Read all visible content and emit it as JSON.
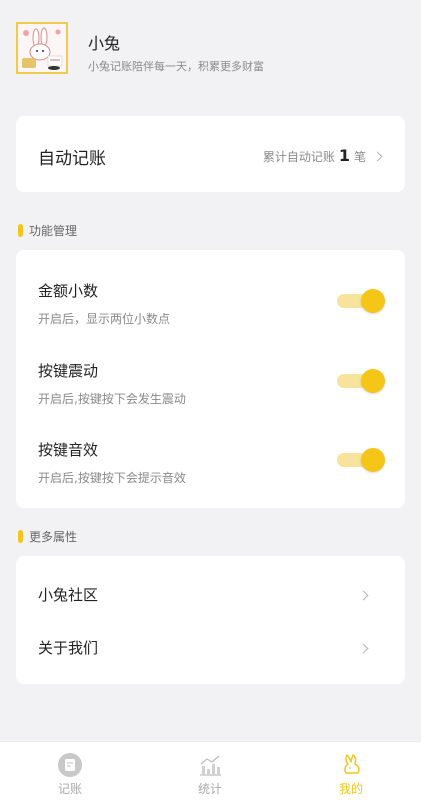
{
  "profile": {
    "name": "小兔",
    "subtitle": "小兔记账陪伴每一天，积累更多财富"
  },
  "auto_record": {
    "title": "自动记账",
    "prefix": "累计自动记账",
    "count": "1",
    "suffix": "笔"
  },
  "features": {
    "section_label": "功能管理",
    "items": [
      {
        "title": "金额小数",
        "desc": "开启后，显示两位小数点",
        "enabled": true
      },
      {
        "title": "按键震动",
        "desc": "开启后,按键按下会发生震动",
        "enabled": true
      },
      {
        "title": "按键音效",
        "desc": "开启后,按键按下会提示音效",
        "enabled": true
      }
    ]
  },
  "more": {
    "section_label": "更多属性",
    "items": [
      {
        "label": "小兔社区"
      },
      {
        "label": "关于我们"
      }
    ]
  },
  "tabbar": {
    "items": [
      {
        "label": "记账",
        "icon": "notebook-icon",
        "active": false
      },
      {
        "label": "统计",
        "icon": "chart-icon",
        "active": false
      },
      {
        "label": "我的",
        "icon": "rabbit-icon",
        "active": true
      }
    ]
  },
  "colors": {
    "accent": "#f5c518",
    "toggle_track": "#f7e39c",
    "background": "#f2f2f5"
  }
}
